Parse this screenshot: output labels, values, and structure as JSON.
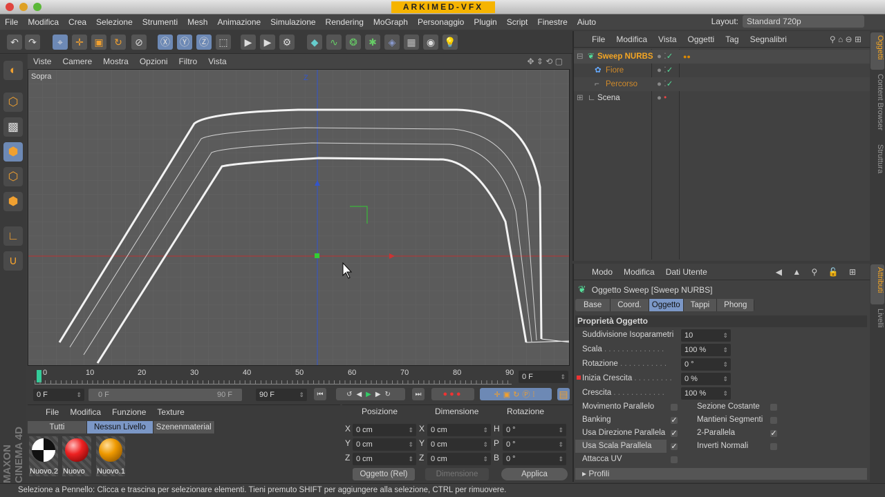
{
  "brand": "ARKIMED-VFX",
  "menu": [
    "File",
    "Modifica",
    "Crea",
    "Selezione",
    "Strumenti",
    "Mesh",
    "Animazione",
    "Simulazione",
    "Rendering",
    "MoGraph",
    "Personaggio",
    "Plugin",
    "Script",
    "Finestre",
    "Aiuto"
  ],
  "layout": {
    "label": "Layout:",
    "value": "Standard 720p"
  },
  "viewport": {
    "menu": [
      "Viste",
      "Camere",
      "Mostra",
      "Opzioni",
      "Filtro",
      "Vista"
    ],
    "view_name": "Sopra",
    "axis_z": "Z"
  },
  "timeline": {
    "ticks": [
      "0",
      "10",
      "20",
      "30",
      "40",
      "50",
      "60",
      "70",
      "80",
      "90"
    ],
    "current_frame": "0 F",
    "start": "0 F",
    "range_start": "0 F",
    "range_end": "90 F",
    "end": "90 F"
  },
  "materials": {
    "menu": [
      "File",
      "Modifica",
      "Funzione",
      "Texture"
    ],
    "tabs": [
      "Tutti",
      "Nessun Livello",
      "Szenenmaterial"
    ],
    "items": [
      {
        "name": "Nuovo.2"
      },
      {
        "name": "Nuovo"
      },
      {
        "name": "Nuovo.1"
      }
    ]
  },
  "coords": {
    "headers": [
      "Posizione",
      "Dimensione",
      "Rotazione"
    ],
    "rows": [
      {
        "a": "X",
        "pos": "0 cm",
        "b": "X",
        "dim": "0 cm",
        "c": "H",
        "rot": "0 °"
      },
      {
        "a": "Y",
        "pos": "0 cm",
        "b": "Y",
        "dim": "0 cm",
        "c": "P",
        "rot": "0 °"
      },
      {
        "a": "Z",
        "pos": "0 cm",
        "b": "Z",
        "dim": "0 cm",
        "c": "B",
        "rot": "0 °"
      }
    ],
    "mode": "Oggetto (Rel)",
    "dim_mode": "Dimensione",
    "apply": "Applica"
  },
  "status": "Selezione a Pennello: Clicca e trascina per selezionare elementi. Tieni premuto SHIFT per aggiungere alla selezione, CTRL per rimuovere.",
  "objects": {
    "menu": [
      "File",
      "Modifica",
      "Vista",
      "Oggetti",
      "Tag",
      "Segnalibri"
    ],
    "items": [
      {
        "name": "Sweep NURBS"
      },
      {
        "name": "Fiore"
      },
      {
        "name": "Percorso"
      },
      {
        "name": "Scena"
      }
    ]
  },
  "attributes": {
    "menu": [
      "Modo",
      "Modifica",
      "Dati Utente"
    ],
    "title": "Oggetto Sweep [Sweep NURBS]",
    "tabs": [
      "Base",
      "Coord.",
      "Oggetto",
      "Tappi",
      "Phong"
    ],
    "section": "Proprietà Oggetto",
    "fields": [
      {
        "label": "Suddivisione Isoparametri",
        "value": "10"
      },
      {
        "label": "Scala",
        "value": "100 %"
      },
      {
        "label": "Rotazione",
        "value": "0 °"
      },
      {
        "label": "Inizia Crescita",
        "value": "0 %"
      },
      {
        "label": "Crescita",
        "value": "100 %"
      }
    ],
    "checks_left": [
      {
        "label": "Movimento Parallelo",
        "checked": false
      },
      {
        "label": "Banking",
        "checked": true
      },
      {
        "label": "Usa Direzione Parallela",
        "checked": true
      },
      {
        "label": "Usa Scala Parallela",
        "checked": true
      },
      {
        "label": "Attacca UV",
        "checked": false
      }
    ],
    "checks_right": [
      {
        "label": "Sezione Costante",
        "checked": false
      },
      {
        "label": "Mantieni Segmenti",
        "checked": false
      },
      {
        "label": "2-Parallela",
        "checked": true
      },
      {
        "label": "Inverti Normali",
        "checked": false
      }
    ],
    "profili": "Profili"
  },
  "side_tabs": [
    "Oggetti",
    "Content Browser",
    "Struttura",
    "Attributi",
    "Livelli"
  ],
  "logo": "MAXON CINEMA 4D",
  "accent": "#f6b400"
}
